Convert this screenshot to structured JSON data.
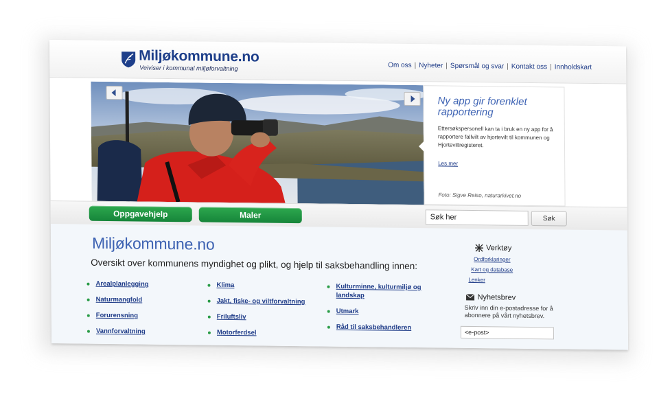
{
  "header": {
    "title": "Miljøkommune.no",
    "tagline": "Veiviser i kommunal miljøforvaltning",
    "nav": [
      "Om oss",
      "Nyheter",
      "Spørsmål og svar",
      "Kontakt oss",
      "Innholdskart"
    ],
    "brand_color": "#1e3f8a"
  },
  "hero": {
    "headline": "Ny app gir forenklet rapportering",
    "body": "Ettersøkspersonell kan ta i bruk en ny app for å rapportere fallvilt av hjortevilt til kommunen og Hjorteviltregisteret.",
    "read_more": "Les mer",
    "credit": "Foto: Sigve Reiso, naturarkivet.no",
    "prev_icon": "chevron-left-icon",
    "next_icon": "chevron-right-icon"
  },
  "toolbar": {
    "button1": "Oppgavehjelp",
    "button2": "Maler",
    "search_placeholder": "Søk her",
    "search_button": "Søk",
    "button_color": "#1f9a45"
  },
  "main": {
    "title": "Miljøkommune.no",
    "subtitle": "Oversikt over kommunens myndighet og plikt, og hjelp til saksbehandling innen:",
    "col1": [
      "Arealplanlegging",
      "Naturmangfold",
      "Forurensning",
      "Vannforvaltning"
    ],
    "col2": [
      "Klima",
      "Jakt, fiske- og viltforvaltning",
      "Friluftsliv",
      "Motorferdsel"
    ],
    "col3": [
      "Kulturminne, kulturmiljø og landskap",
      "Utmark",
      "Råd til saksbehandleren"
    ]
  },
  "sidebar": {
    "tools_heading": "Verktøy",
    "tools_icon": "tools-icon",
    "tools_links": [
      "Ordforklaringer",
      "Kart og database",
      "Lenker"
    ],
    "newsletter_heading": "Nyhetsbrev",
    "newsletter_icon": "envelope-icon",
    "newsletter_text": "Skriv inn din e-postadresse for å abonnere på vårt nyhetsbrev.",
    "email_placeholder": "<e-post>"
  }
}
